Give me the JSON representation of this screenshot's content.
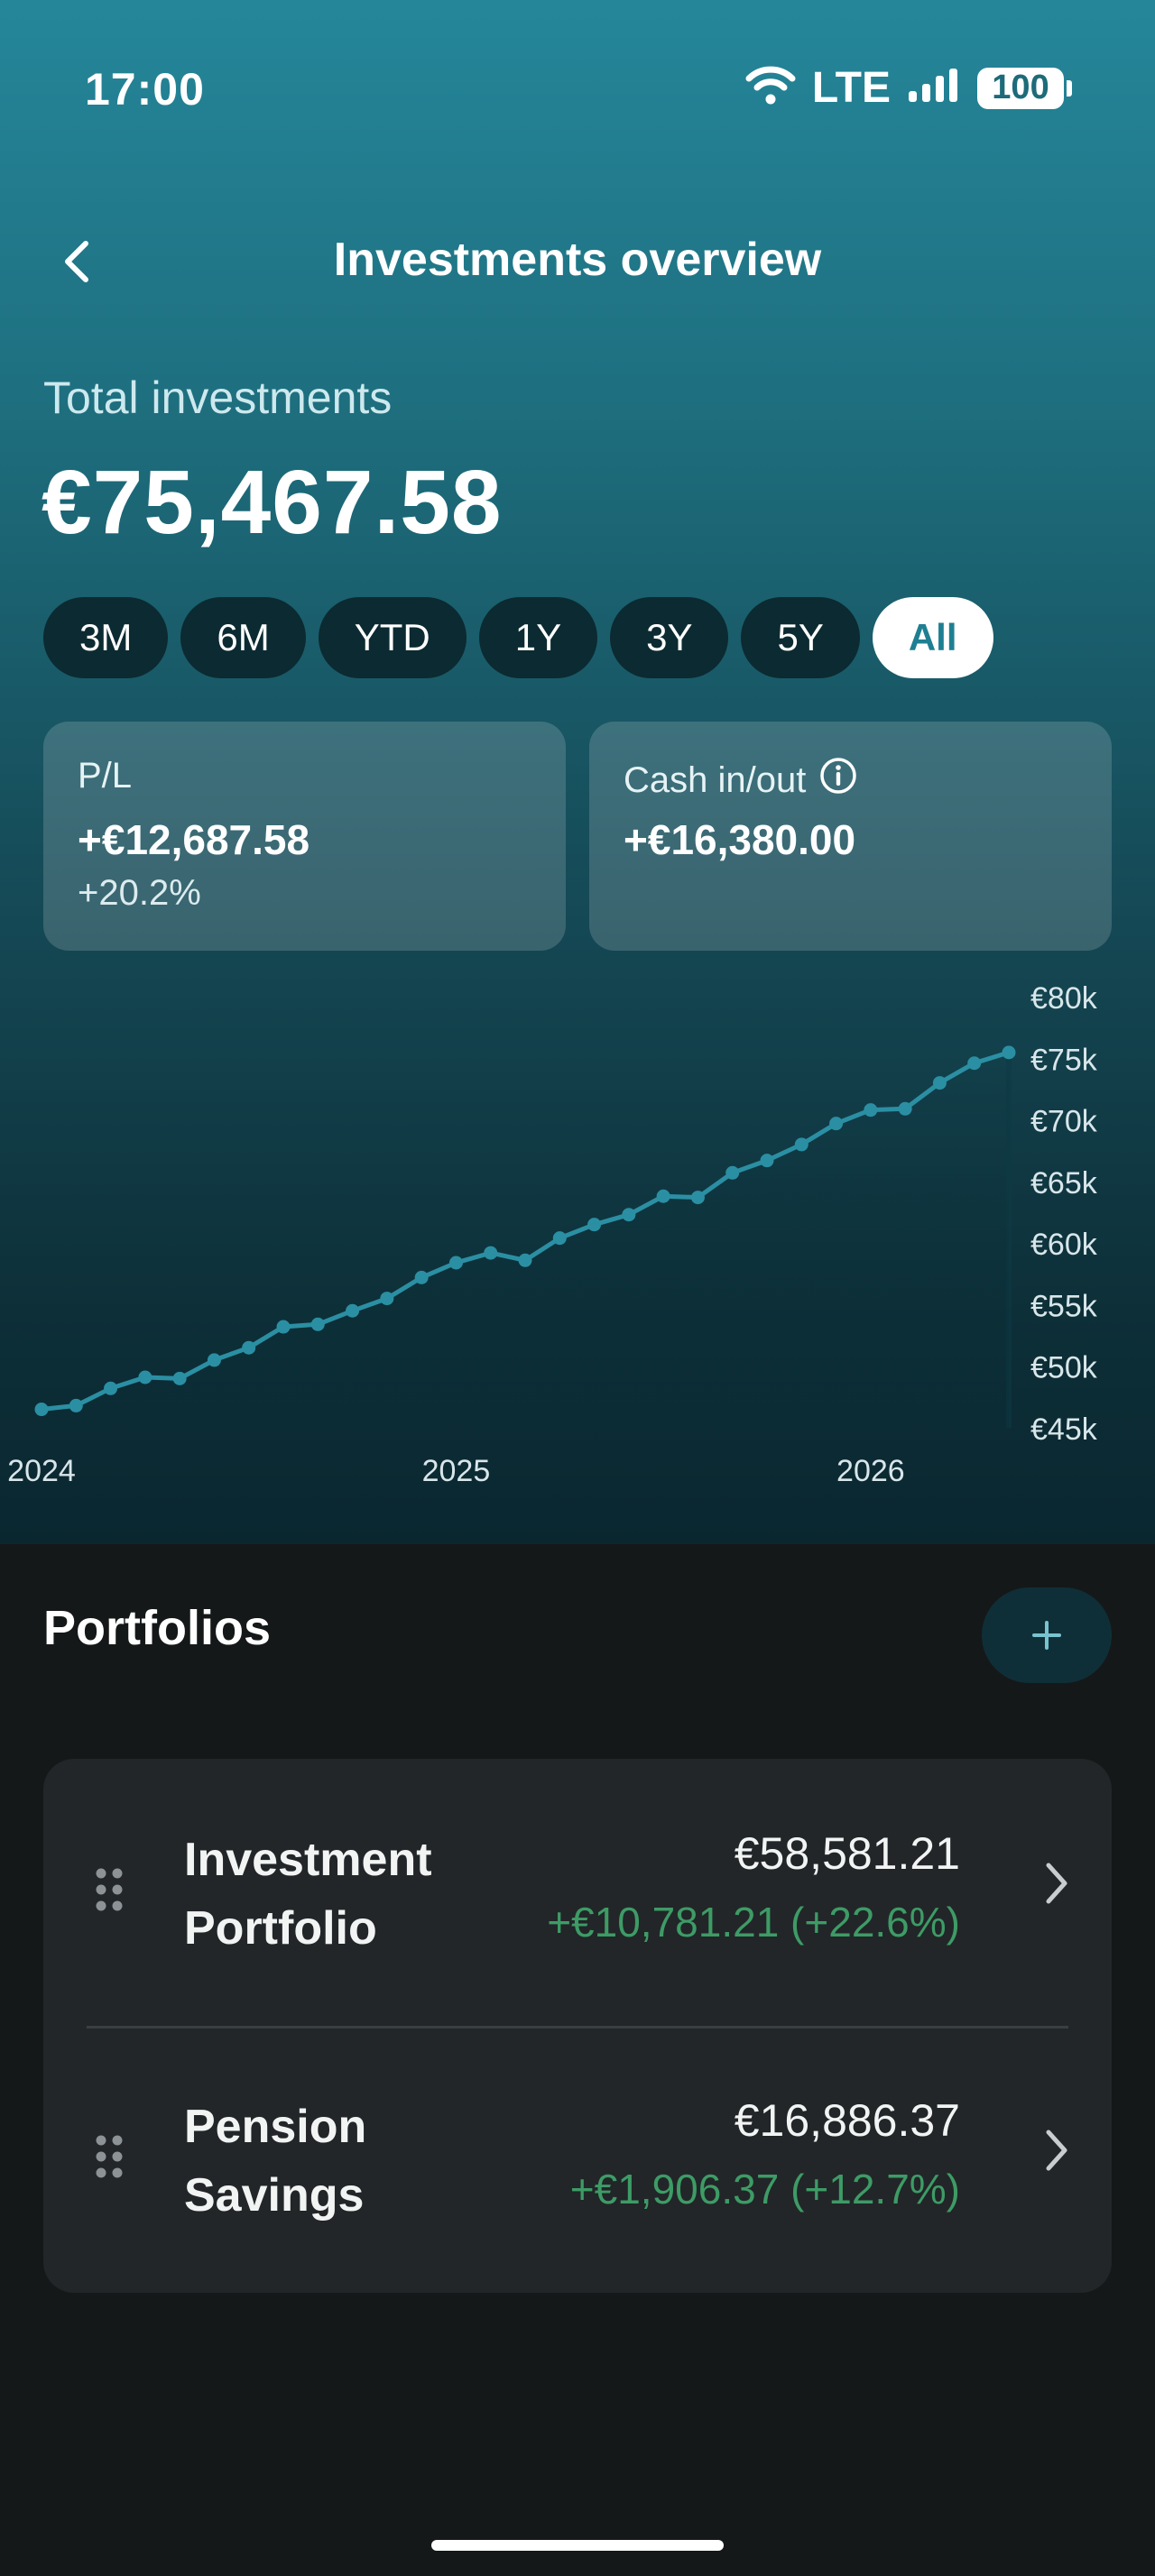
{
  "status": {
    "time": "17:00",
    "network": "LTE",
    "battery": "100"
  },
  "header": {
    "title": "Investments overview"
  },
  "summary": {
    "label": "Total investments",
    "value": "€75,467.58"
  },
  "ranges": [
    "3M",
    "6M",
    "YTD",
    "1Y",
    "3Y",
    "5Y",
    "All"
  ],
  "selected_range": "All",
  "cards": {
    "pl": {
      "label": "P/L",
      "value": "+€12,687.58",
      "pct": "+20.2%"
    },
    "cash": {
      "label": "Cash in/out",
      "value": "+€16,380.00"
    }
  },
  "chart_data": {
    "type": "line",
    "ylim": [
      45000,
      80000
    ],
    "y_ticks": [
      "€80k",
      "€75k",
      "€70k",
      "€65k",
      "€60k",
      "€55k",
      "€50k",
      "€45k"
    ],
    "y_tick_values": [
      80000,
      75000,
      70000,
      65000,
      60000,
      55000,
      50000,
      45000
    ],
    "x_ticks": [
      "2024",
      "2025",
      "2026"
    ],
    "x_range": [
      "2024-01",
      "2026-05"
    ],
    "x": [
      "2024-01",
      "2024-02",
      "2024-03",
      "2024-04",
      "2024-05",
      "2024-06",
      "2024-07",
      "2024-08",
      "2024-09",
      "2024-10",
      "2024-11",
      "2024-12",
      "2025-01",
      "2025-02",
      "2025-03",
      "2025-04",
      "2025-05",
      "2025-06",
      "2025-07",
      "2025-08",
      "2025-09",
      "2025-10",
      "2025-11",
      "2025-12",
      "2026-01",
      "2026-02",
      "2026-03",
      "2026-04",
      "2026-05"
    ],
    "series": [
      {
        "values": [
          46500,
          46800,
          48200,
          49100,
          49000,
          50500,
          51500,
          53200,
          53400,
          54500,
          55500,
          57200,
          58400,
          59200,
          58600,
          60400,
          61500,
          62300,
          63800,
          63700,
          65700,
          66700,
          68000,
          69700,
          70800,
          70900,
          73000,
          74600,
          75470
        ]
      }
    ],
    "grid": false
  },
  "portfolios": {
    "title": "Portfolios",
    "items": [
      {
        "name_line1": "Investment",
        "name_line2": "Portfolio",
        "amount": "€58,581.21",
        "gain": "+€10,781.21 (+22.6%)"
      },
      {
        "name_line1": "Pension",
        "name_line2": "Savings",
        "amount": "€16,886.37",
        "gain": "+€1,906.37 (+12.7%)"
      }
    ]
  }
}
